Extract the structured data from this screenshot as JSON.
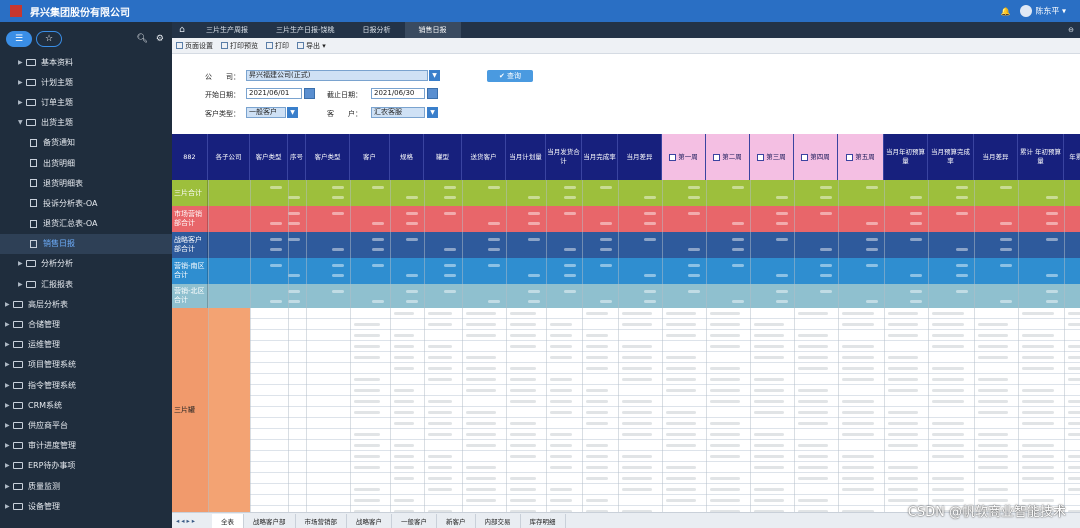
{
  "header": {
    "company": "昇兴集团股份有限公司",
    "user": "陈东平"
  },
  "sidebar": {
    "items": [
      {
        "label": "基本资料",
        "level": 1
      },
      {
        "label": "计划主题",
        "level": 1
      },
      {
        "label": "订单主题",
        "level": 1
      },
      {
        "label": "出货主题",
        "level": 1,
        "open": true
      },
      {
        "label": "备货通知",
        "level": 2
      },
      {
        "label": "出货明细",
        "level": 2
      },
      {
        "label": "退货明细表",
        "level": 2
      },
      {
        "label": "投诉分析表-OA",
        "level": 2
      },
      {
        "label": "退货汇总表-OA",
        "level": 2
      },
      {
        "label": "销售日报",
        "level": 2,
        "active": true
      },
      {
        "label": "分析分析",
        "level": 1
      },
      {
        "label": "汇报报表",
        "level": 1
      },
      {
        "label": "高层分析表",
        "level": 0
      },
      {
        "label": "合储管理",
        "level": 0
      },
      {
        "label": "运维管理",
        "level": 0
      },
      {
        "label": "项目管理系统",
        "level": 0
      },
      {
        "label": "指令管理系统",
        "level": 0
      },
      {
        "label": "CRM系统",
        "level": 0
      },
      {
        "label": "供应商平台",
        "level": 0
      },
      {
        "label": "审计进度管理",
        "level": 0
      },
      {
        "label": "ERP待办事项",
        "level": 0
      },
      {
        "label": "质量监测",
        "level": 0
      },
      {
        "label": "设备管理",
        "level": 0
      }
    ]
  },
  "tabs": [
    {
      "label": "三片生产周报"
    },
    {
      "label": "三片生产日报-饶桃"
    },
    {
      "label": "日报分析"
    },
    {
      "label": "销售日报",
      "active": true
    }
  ],
  "toolbar": {
    "page_setup": "页面设置",
    "print_preview": "打印预览",
    "print": "打印",
    "export": "导出"
  },
  "filter": {
    "company_label": "公　　司：",
    "company_value": "昇兴福建公司(正式)",
    "start_label": "开始日期：",
    "start_value": "2021/06/01",
    "end_label": "截止日期：",
    "end_value": "2021/06/30",
    "custtype_label": "客户类型：",
    "custtype_value": "一般客户",
    "cust_label": "客　　户：",
    "cust_value": "汇农客服",
    "query": "查询"
  },
  "grid": {
    "corner": "882",
    "headers": [
      "各子公司",
      "客户类型",
      "序号",
      "客户类型",
      "客户",
      "规格",
      "罐型",
      "送货客户",
      "当月计划量",
      "当月发货合计",
      "当月完成率",
      "当月差异"
    ],
    "weeks": [
      "第一周",
      "第二周",
      "第三周",
      "第四周",
      "第五周"
    ],
    "tail": [
      "当月年初预算量",
      "当月预算完成率",
      "当月差异",
      "累计 年初预算量",
      "年累计发货"
    ],
    "groups": [
      {
        "label": "三片合计",
        "color": "#9dbf3c"
      },
      {
        "label": "市场营销部合计",
        "color": "#e8666a"
      },
      {
        "label": "战略客户部合计",
        "color": "#2e5a9c"
      },
      {
        "label": "营销-南区合计",
        "color": "#2f8ed0"
      },
      {
        "label": "营销-北区合计",
        "color": "#8fc0cf"
      }
    ],
    "section_label": "三片罐"
  },
  "sheets": [
    "全表",
    "战略客户部",
    "市场营销部",
    "战略客户",
    "一般客户",
    "新客户",
    "内部交易",
    "库存明细"
  ],
  "watermark": "CSDN @帆软商业智能技术"
}
